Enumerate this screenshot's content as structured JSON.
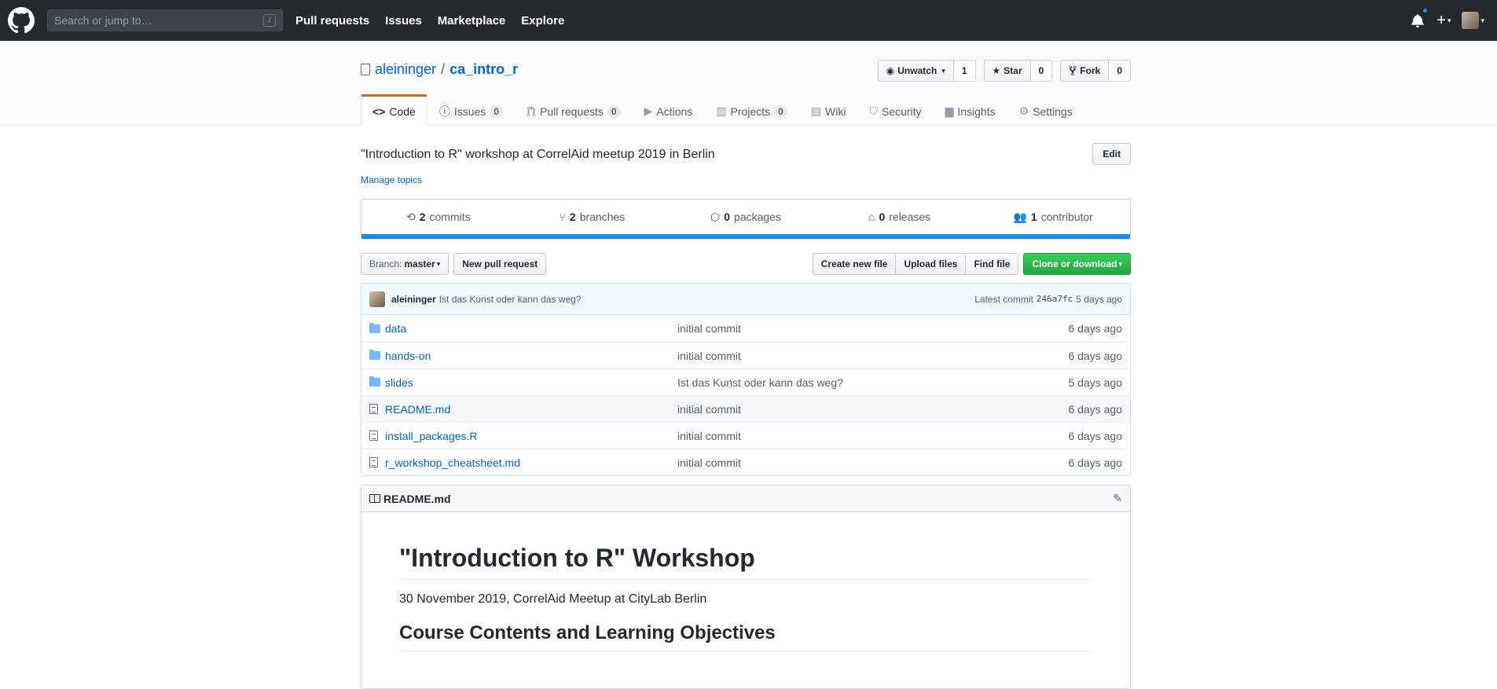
{
  "header": {
    "search_placeholder": "Search or jump to…",
    "search_key": "/",
    "nav": [
      "Pull requests",
      "Issues",
      "Marketplace",
      "Explore"
    ]
  },
  "repo": {
    "owner": "aleininger",
    "separator": "/",
    "name": "ca_intro_r",
    "watch": {
      "label": "Unwatch",
      "count": "1"
    },
    "star": {
      "label": "Star",
      "count": "0"
    },
    "fork": {
      "label": "Fork",
      "count": "0"
    },
    "tabs": [
      {
        "label": "Code",
        "counter": ""
      },
      {
        "label": "Issues",
        "counter": "0"
      },
      {
        "label": "Pull requests",
        "counter": "0"
      },
      {
        "label": "Actions",
        "counter": ""
      },
      {
        "label": "Projects",
        "counter": "0"
      },
      {
        "label": "Wiki",
        "counter": ""
      },
      {
        "label": "Security",
        "counter": ""
      },
      {
        "label": "Insights",
        "counter": ""
      },
      {
        "label": "Settings",
        "counter": ""
      }
    ],
    "description": "\"Introduction to R\" workshop at CorrelAid meetup 2019 in Berlin",
    "edit_label": "Edit",
    "manage_topics": "Manage topics"
  },
  "summary": {
    "commits": {
      "num": "2",
      "label": "commits"
    },
    "branches": {
      "num": "2",
      "label": "branches"
    },
    "packages": {
      "num": "0",
      "label": "packages"
    },
    "releases": {
      "num": "0",
      "label": "releases"
    },
    "contributors": {
      "num": "1",
      "label": "contributor"
    },
    "lang_color": "#198ce7"
  },
  "filebar": {
    "branch_label": "Branch:",
    "branch": "master",
    "new_pr": "New pull request",
    "create_file": "Create new file",
    "upload": "Upload files",
    "find": "Find file",
    "clone": "Clone or download"
  },
  "commit": {
    "author": "aleininger",
    "message": "Ist das Kunst oder kann das weg?",
    "latest_label": "Latest commit",
    "sha": "246a7fc",
    "age": "5 days ago"
  },
  "files": [
    {
      "type": "dir",
      "name": "data",
      "message": "initial commit",
      "age": "6 days ago"
    },
    {
      "type": "dir",
      "name": "hands-on",
      "message": "initial commit",
      "age": "6 days ago"
    },
    {
      "type": "dir",
      "name": "slides",
      "message": "Ist das Kunst oder kann das weg?",
      "age": "5 days ago"
    },
    {
      "type": "file",
      "name": "README.md",
      "message": "initial commit",
      "age": "6 days ago"
    },
    {
      "type": "file",
      "name": "install_packages.R",
      "message": "initial commit",
      "age": "6 days ago"
    },
    {
      "type": "file",
      "name": "r_workshop_cheatsheet.md",
      "message": "initial commit",
      "age": "6 days ago"
    }
  ],
  "readme": {
    "filename": "README.md",
    "h1": "\"Introduction to R\" Workshop",
    "subtitle": "30 November 2019, CorrelAid Meetup at CityLab Berlin",
    "h2": "Course Contents and Learning Objectives"
  }
}
